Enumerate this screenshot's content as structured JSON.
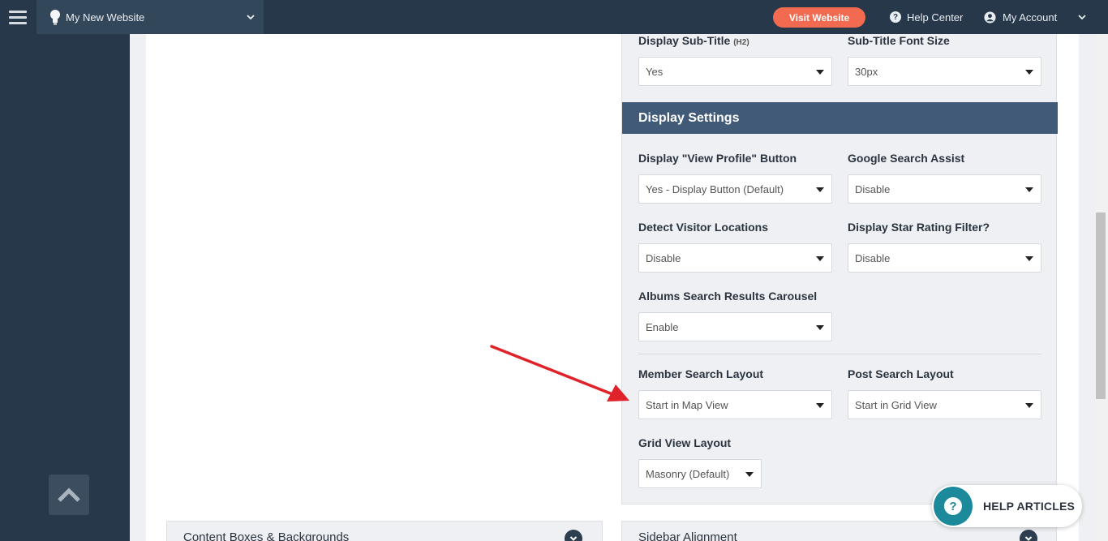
{
  "topbar": {
    "site_name": "My New Website",
    "visit_button": "Visit Website",
    "help_center": "Help Center",
    "my_account": "My Account"
  },
  "fields": {
    "sub_title_label": "Display Sub-Title",
    "sub_title_tag": "(H2)",
    "sub_title_value": "Yes",
    "sub_title_font_label": "Sub-Title Font Size",
    "sub_title_font_value": "30px",
    "section_title": "Display Settings",
    "view_profile_label": "Display \"View Profile\" Button",
    "view_profile_value": "Yes - Display Button (Default)",
    "google_assist_label": "Google Search Assist",
    "google_assist_value": "Disable",
    "detect_visitor_label": "Detect Visitor Locations",
    "detect_visitor_value": "Disable",
    "star_rating_label": "Display Star Rating Filter?",
    "star_rating_value": "Disable",
    "albums_carousel_label": "Albums Search Results Carousel",
    "albums_carousel_value": "Enable",
    "member_layout_label": "Member Search Layout",
    "member_layout_value": "Start in Map View",
    "post_layout_label": "Post Search Layout",
    "post_layout_value": "Start in Grid View",
    "grid_layout_label": "Grid View Layout",
    "grid_layout_value": "Masonry (Default)"
  },
  "bottom": {
    "content_boxes": "Content Boxes & Backgrounds",
    "sidebar_alignment": "Sidebar Alignment"
  },
  "help_articles": "HELP ARTICLES",
  "colors": {
    "topbar": "#26384a",
    "accent": "#f26b50",
    "section_header": "#415a77",
    "help_teal": "#1c8a9a",
    "arrow": "#e0232a"
  }
}
